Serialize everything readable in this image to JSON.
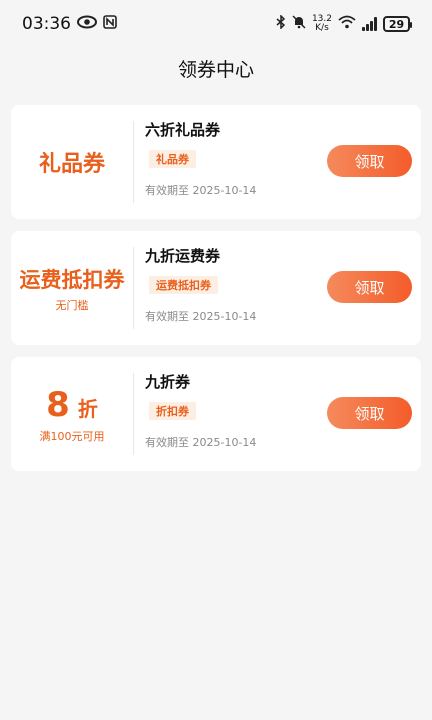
{
  "status": {
    "time": "03:36",
    "speed_value": "13.2",
    "speed_unit": "K/s",
    "battery": "29"
  },
  "header": {
    "title": "领券中心"
  },
  "coupons": [
    {
      "badge": "礼品券",
      "badge_sub": "",
      "name": "六折礼品券",
      "tag": "礼品券",
      "validity": "有效期至 2025-10-14",
      "button": "领取"
    },
    {
      "badge": "运费抵扣券",
      "badge_sub": "无门槛",
      "name": "九折运费券",
      "tag": "运费抵扣券",
      "validity": "有效期至 2025-10-14",
      "button": "领取"
    },
    {
      "discount_value": "8",
      "discount_unit": "折",
      "badge_sub": "满100元可用",
      "name": "九折券",
      "tag": "折扣券",
      "validity": "有效期至 2025-10-14",
      "button": "领取"
    }
  ],
  "colors": {
    "accent": "#e8601c",
    "button_start": "#f58a5c",
    "button_end": "#f45c2a",
    "tag_bg": "#fdeee3"
  },
  "icons": [
    "eye-icon",
    "nfc-icon",
    "bluetooth-icon",
    "mute-icon",
    "wifi-icon",
    "signal-icon",
    "battery-icon"
  ]
}
